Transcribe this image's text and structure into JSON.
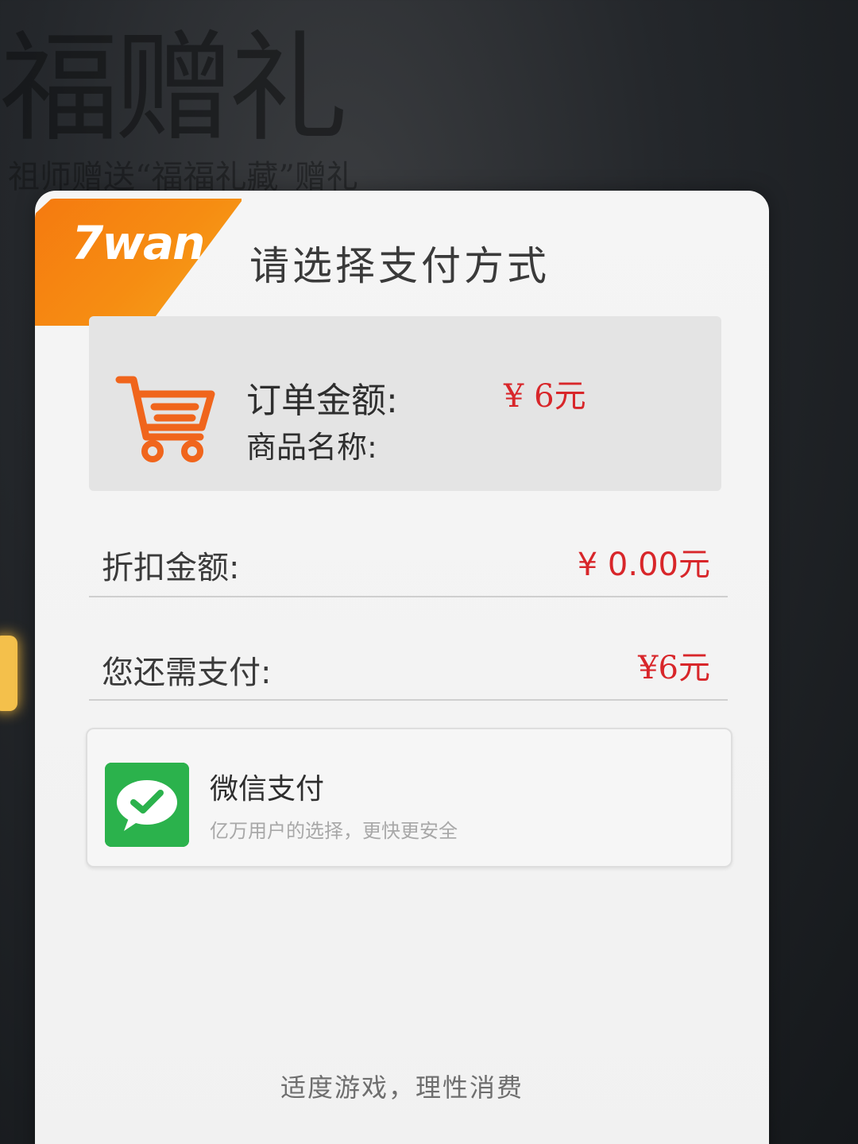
{
  "background": {
    "title": "福赠礼",
    "subtitle": "祖师赠送“福福礼藏”赠礼"
  },
  "dialog": {
    "logo_text": "7wan",
    "title": "请选择支付方式"
  },
  "order": {
    "amount_label": "订单金额:",
    "amount_value": "¥ 6元",
    "goods_name_label": "商品名称:"
  },
  "discount": {
    "label": "折扣金额:",
    "value": "¥ 0.00元"
  },
  "due": {
    "label": "您还需支付:",
    "value": "¥6元"
  },
  "payment_methods": [
    {
      "name": "微信支付",
      "description": "亿万用户的选择，更快更安全",
      "icon": "wechat-pay-icon"
    }
  ],
  "footer": {
    "note": "适度游戏，理性消费"
  },
  "colors": {
    "accent_orange": "#f57a10",
    "amount_red": "#d8262a",
    "wechat_green": "#2bb24c"
  }
}
